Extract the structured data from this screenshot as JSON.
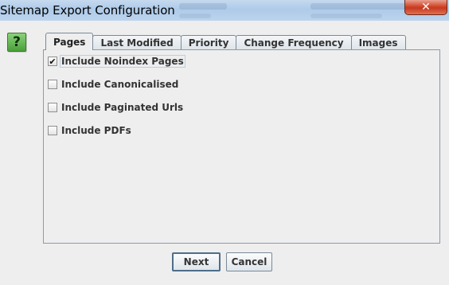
{
  "window": {
    "title": "Sitemap Export Configuration",
    "close_glyph": "✕"
  },
  "help": {
    "glyph": "?",
    "icon": "help-icon",
    "color": "#4aa03a"
  },
  "tabs": [
    {
      "label": "Pages",
      "active": true
    },
    {
      "label": "Last Modified",
      "active": false
    },
    {
      "label": "Priority",
      "active": false
    },
    {
      "label": "Change Frequency",
      "active": false
    },
    {
      "label": "Images",
      "active": false
    }
  ],
  "options": [
    {
      "label": "Include Noindex Pages",
      "checked": true
    },
    {
      "label": "Include Canonicalised",
      "checked": false
    },
    {
      "label": "Include Paginated Urls",
      "checked": false
    },
    {
      "label": "Include PDFs",
      "checked": false
    }
  ],
  "buttons": {
    "next_label": "Next",
    "cancel_label": "Cancel"
  }
}
